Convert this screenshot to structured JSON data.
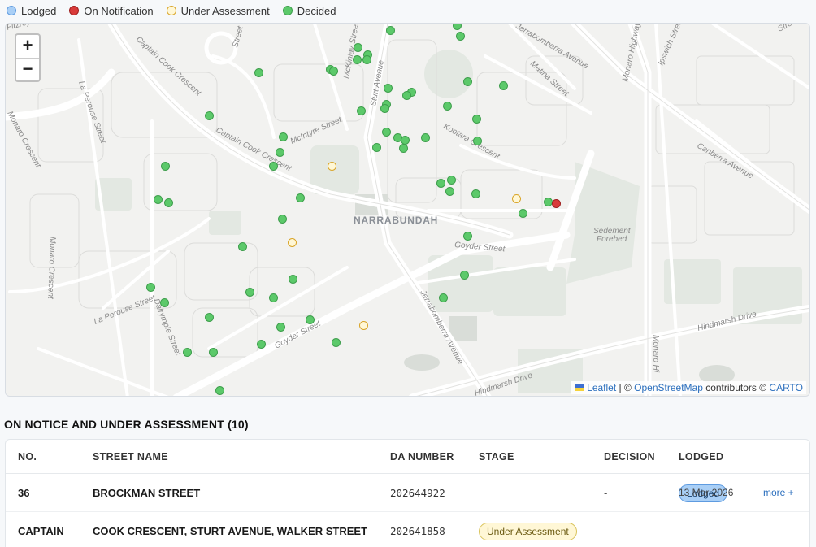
{
  "legend": [
    {
      "label": "Lodged",
      "color": "#a9cff6",
      "border": "#5e9be0"
    },
    {
      "label": "On Notification",
      "color": "#d83a3a",
      "border": "#9f1f1f"
    },
    {
      "label": "Under Assessment",
      "color": "#fff7d6",
      "border": "#d9a528"
    },
    {
      "label": "Decided",
      "color": "#5cc96a",
      "border": "#3e9e4c"
    }
  ],
  "map": {
    "zoom_in": "+",
    "zoom_out": "−",
    "labels": {
      "suburb": "NARRABUNDAH",
      "captain_cook_1": "Captain Cook Crescent",
      "captain_cook_2": "Captain Cook Crescent",
      "la_perouse_1": "La Perouse Street",
      "la_perouse_2": "La Perouse Street",
      "monaro_cr_1": "Monaro Crescent",
      "monaro_cr_2": "Monaro Crescent",
      "mcintyre": "McIntyre Street",
      "mckinlay": "McKinlay Street",
      "sturt": "Sturt Avenue",
      "kootara": "Kootara Crescent",
      "matina": "Matina Street",
      "monaro_hwy": "Monaro Highway",
      "monaro_hwy_2": "Monaro Hi",
      "ipswich": "Ipswich Street",
      "canberra": "Canberra Avenue",
      "jerra_top": "Jerrabomberra Avenue",
      "jerra": "Jerrabomberra Avenue",
      "goyder_1": "Goyder Street",
      "goyder_2": "Goyder Street",
      "dalrymple": "Dalrymple Street",
      "hindmarsh_1": "Hindmarsh Drive",
      "hindmarsh_2": "Hindmarsh Drive",
      "sedement": "Sedement",
      "forebed": "Forebed",
      "street_tr": "Street",
      "fitz": "Fitzroy",
      "st_label": "Street"
    },
    "attribution": {
      "leaflet": "Leaflet",
      "sep1": " | © ",
      "osm": "OpenStreetMap",
      "contrib": " contributors © ",
      "carto": "CARTO"
    }
  },
  "section_title": "ON NOTICE AND UNDER ASSESSMENT (10)",
  "table": {
    "headers": {
      "no": "NO.",
      "street": "STREET NAME",
      "da": "DA NUMBER",
      "stage": "STAGE",
      "decision": "DECISION",
      "lodged": "LODGED"
    },
    "rows": [
      {
        "no": "36",
        "street": "BROCKMAN STREET",
        "da": "202644922",
        "stage": "Lodged",
        "decision": "-",
        "lodged": "13 Mar 2026",
        "more": "more +"
      },
      {
        "no": "CAPTAIN",
        "street": "COOK CRESCENT, STURT AVENUE, WALKER STREET",
        "da": "202641858",
        "stage": "Under Assessment",
        "decision": "",
        "lodged": "",
        "more": ""
      }
    ]
  }
}
